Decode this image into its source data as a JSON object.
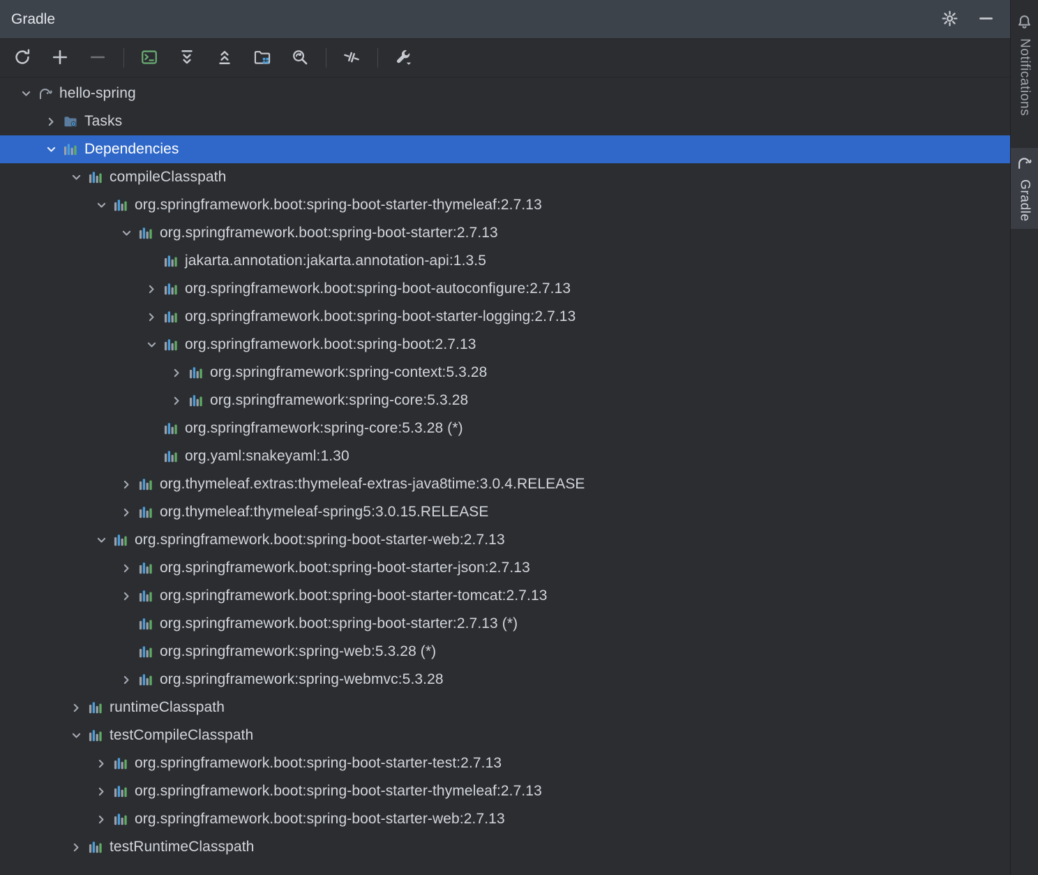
{
  "titlebar": {
    "title": "Gradle"
  },
  "toolbar": {
    "items": [
      {
        "type": "button",
        "name": "reload-gradle-button",
        "icon": "reload-icon"
      },
      {
        "type": "button",
        "name": "link-project-button",
        "icon": "add-icon"
      },
      {
        "type": "button",
        "name": "unlink-project-button",
        "icon": "remove-icon",
        "disabled": true
      },
      {
        "type": "separator"
      },
      {
        "type": "button",
        "name": "execute-task-button",
        "icon": "execute-task-icon"
      },
      {
        "type": "button",
        "name": "expand-all-button",
        "icon": "expand-all-icon"
      },
      {
        "type": "button",
        "name": "collapse-all-button",
        "icon": "collapse-all-icon"
      },
      {
        "type": "button",
        "name": "group-modules-button",
        "icon": "group-modules-icon"
      },
      {
        "type": "button",
        "name": "dependency-analyzer-button",
        "icon": "dependency-analyzer-icon"
      },
      {
        "type": "separator"
      },
      {
        "type": "button",
        "name": "toggle-offline-button",
        "icon": "toggle-offline-icon"
      },
      {
        "type": "separator"
      },
      {
        "type": "button",
        "name": "gradle-settings-button",
        "icon": "settings-wrench-icon"
      }
    ]
  },
  "tree": {
    "rows": [
      {
        "label": "hello-spring",
        "depth": 0,
        "state": "expanded",
        "icon": "gradle-elephant"
      },
      {
        "label": "Tasks",
        "depth": 1,
        "state": "collapsed",
        "icon": "tasks-folder"
      },
      {
        "label": "Dependencies",
        "depth": 1,
        "state": "expanded",
        "icon": "dependency",
        "selected": true
      },
      {
        "label": "compileClasspath",
        "depth": 2,
        "state": "expanded",
        "icon": "dependency"
      },
      {
        "label": "org.springframework.boot:spring-boot-starter-thymeleaf:2.7.13",
        "depth": 3,
        "state": "expanded",
        "icon": "dependency"
      },
      {
        "label": "org.springframework.boot:spring-boot-starter:2.7.13",
        "depth": 4,
        "state": "expanded",
        "icon": "dependency"
      },
      {
        "label": "jakarta.annotation:jakarta.annotation-api:1.3.5",
        "depth": 5,
        "state": "leaf",
        "icon": "dependency"
      },
      {
        "label": "org.springframework.boot:spring-boot-autoconfigure:2.7.13",
        "depth": 5,
        "state": "collapsed",
        "icon": "dependency"
      },
      {
        "label": "org.springframework.boot:spring-boot-starter-logging:2.7.13",
        "depth": 5,
        "state": "collapsed",
        "icon": "dependency"
      },
      {
        "label": "org.springframework.boot:spring-boot:2.7.13",
        "depth": 5,
        "state": "expanded",
        "icon": "dependency"
      },
      {
        "label": "org.springframework:spring-context:5.3.28",
        "depth": 6,
        "state": "collapsed",
        "icon": "dependency"
      },
      {
        "label": "org.springframework:spring-core:5.3.28",
        "depth": 6,
        "state": "collapsed",
        "icon": "dependency"
      },
      {
        "label": "org.springframework:spring-core:5.3.28 (*)",
        "depth": 5,
        "state": "leaf",
        "icon": "dependency"
      },
      {
        "label": "org.yaml:snakeyaml:1.30",
        "depth": 5,
        "state": "leaf",
        "icon": "dependency"
      },
      {
        "label": "org.thymeleaf.extras:thymeleaf-extras-java8time:3.0.4.RELEASE",
        "depth": 4,
        "state": "collapsed",
        "icon": "dependency"
      },
      {
        "label": "org.thymeleaf:thymeleaf-spring5:3.0.15.RELEASE",
        "depth": 4,
        "state": "collapsed",
        "icon": "dependency"
      },
      {
        "label": "org.springframework.boot:spring-boot-starter-web:2.7.13",
        "depth": 3,
        "state": "expanded",
        "icon": "dependency"
      },
      {
        "label": "org.springframework.boot:spring-boot-starter-json:2.7.13",
        "depth": 4,
        "state": "collapsed",
        "icon": "dependency"
      },
      {
        "label": "org.springframework.boot:spring-boot-starter-tomcat:2.7.13",
        "depth": 4,
        "state": "collapsed",
        "icon": "dependency"
      },
      {
        "label": "org.springframework.boot:spring-boot-starter:2.7.13 (*)",
        "depth": 4,
        "state": "leaf",
        "icon": "dependency"
      },
      {
        "label": "org.springframework:spring-web:5.3.28 (*)",
        "depth": 4,
        "state": "leaf",
        "icon": "dependency"
      },
      {
        "label": "org.springframework:spring-webmvc:5.3.28",
        "depth": 4,
        "state": "collapsed",
        "icon": "dependency"
      },
      {
        "label": "runtimeClasspath",
        "depth": 2,
        "state": "collapsed",
        "icon": "dependency"
      },
      {
        "label": "testCompileClasspath",
        "depth": 2,
        "state": "expanded",
        "icon": "dependency"
      },
      {
        "label": "org.springframework.boot:spring-boot-starter-test:2.7.13",
        "depth": 3,
        "state": "collapsed",
        "icon": "dependency"
      },
      {
        "label": "org.springframework.boot:spring-boot-starter-thymeleaf:2.7.13",
        "depth": 3,
        "state": "collapsed",
        "icon": "dependency"
      },
      {
        "label": "org.springframework.boot:spring-boot-starter-web:2.7.13",
        "depth": 3,
        "state": "collapsed",
        "icon": "dependency"
      },
      {
        "label": "testRuntimeClasspath",
        "depth": 2,
        "state": "collapsed",
        "icon": "dependency"
      }
    ]
  },
  "stripe": {
    "notifications_label": "Notifications",
    "gradle_label": "Gradle"
  },
  "colors": {
    "selection_blue": "#3068c9",
    "titlebar_background": "#3d434b",
    "panel_background": "#2b2d31",
    "accent_blue": "#4a9edb",
    "accent_green": "#5fad65",
    "text": "#d2d5db"
  }
}
